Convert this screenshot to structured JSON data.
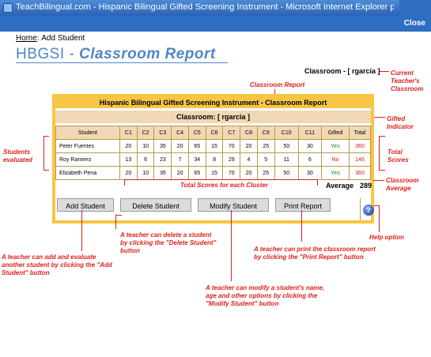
{
  "window": {
    "title": "TeachBilingual.com - Hispanic Bilingual Gifted Screening Instrument - Microsoft Internet Explorer provided by America ...",
    "close_label": "Close"
  },
  "breadcrumb": {
    "home": "Home",
    "separator": ":",
    "current": "Add Student"
  },
  "page_title": {
    "prefix": "HBGSI - ",
    "emphasis": "Classroom Report"
  },
  "classroom": {
    "label": "Classroom - [ rgarcia ]"
  },
  "report": {
    "title": "Hispanic Bilingual Gifted Screening Instrument - Classroom Report",
    "classroom_line": "Classroom: [ rgarcia ]",
    "columns": [
      "Student",
      "C1",
      "C2",
      "C3",
      "C4",
      "C5",
      "C6",
      "C7",
      "C8",
      "C9",
      "C10",
      "C11",
      "Gifted",
      "Total"
    ],
    "rows": [
      {
        "student": "Peter Fuentes",
        "scores": [
          "20",
          "10",
          "35",
          "20",
          "65",
          "15",
          "70",
          "20",
          "25",
          "50",
          "30"
        ],
        "gifted": "Yes",
        "total": "360"
      },
      {
        "student": "Roy Ramirez",
        "scores": [
          "13",
          "6",
          "23",
          "7",
          "34",
          "8",
          "29",
          "4",
          "5",
          "11",
          "6"
        ],
        "gifted": "No",
        "total": "146"
      },
      {
        "student": "Elizabeth Pena",
        "scores": [
          "20",
          "10",
          "35",
          "20",
          "65",
          "15",
          "70",
          "20",
          "25",
          "50",
          "30"
        ],
        "gifted": "Yes",
        "total": "360"
      }
    ],
    "average_label": "Average",
    "average_value": "289"
  },
  "buttons": {
    "add": "Add Student",
    "delete": "Delete Student",
    "modify": "Modify Student",
    "print": "Print Report",
    "help": "?"
  },
  "annotations": {
    "current_teacher": "Current Teacher's Classroom",
    "classroom_report": "Classroom Report",
    "gifted_indicator": "Gifted Indicator",
    "students_evaluated": "Students evaluated",
    "total_scores": "Total Scores",
    "cluster_totals": "Total Scores for each Cluster",
    "classroom_average": "Classroom Average",
    "help_option": "Help option",
    "delete_note": "A teacher can delete a student by clicking the \"Delete Student\" button",
    "print_note": "A teacher can print the classroom report by clicking the \"Print Report\" button",
    "add_note": "A teacher can add and evaluate another student by clicking the \"Add Student\" button",
    "modify_note": "A teacher can modify a student's name, age and other options by clicking the \"Modify Student\" button"
  },
  "colors": {
    "accent_blue": "#2e6dbf",
    "annotation_red": "#e0201b",
    "report_gold": "#f8c544",
    "header_tan": "#f0d8b4"
  }
}
